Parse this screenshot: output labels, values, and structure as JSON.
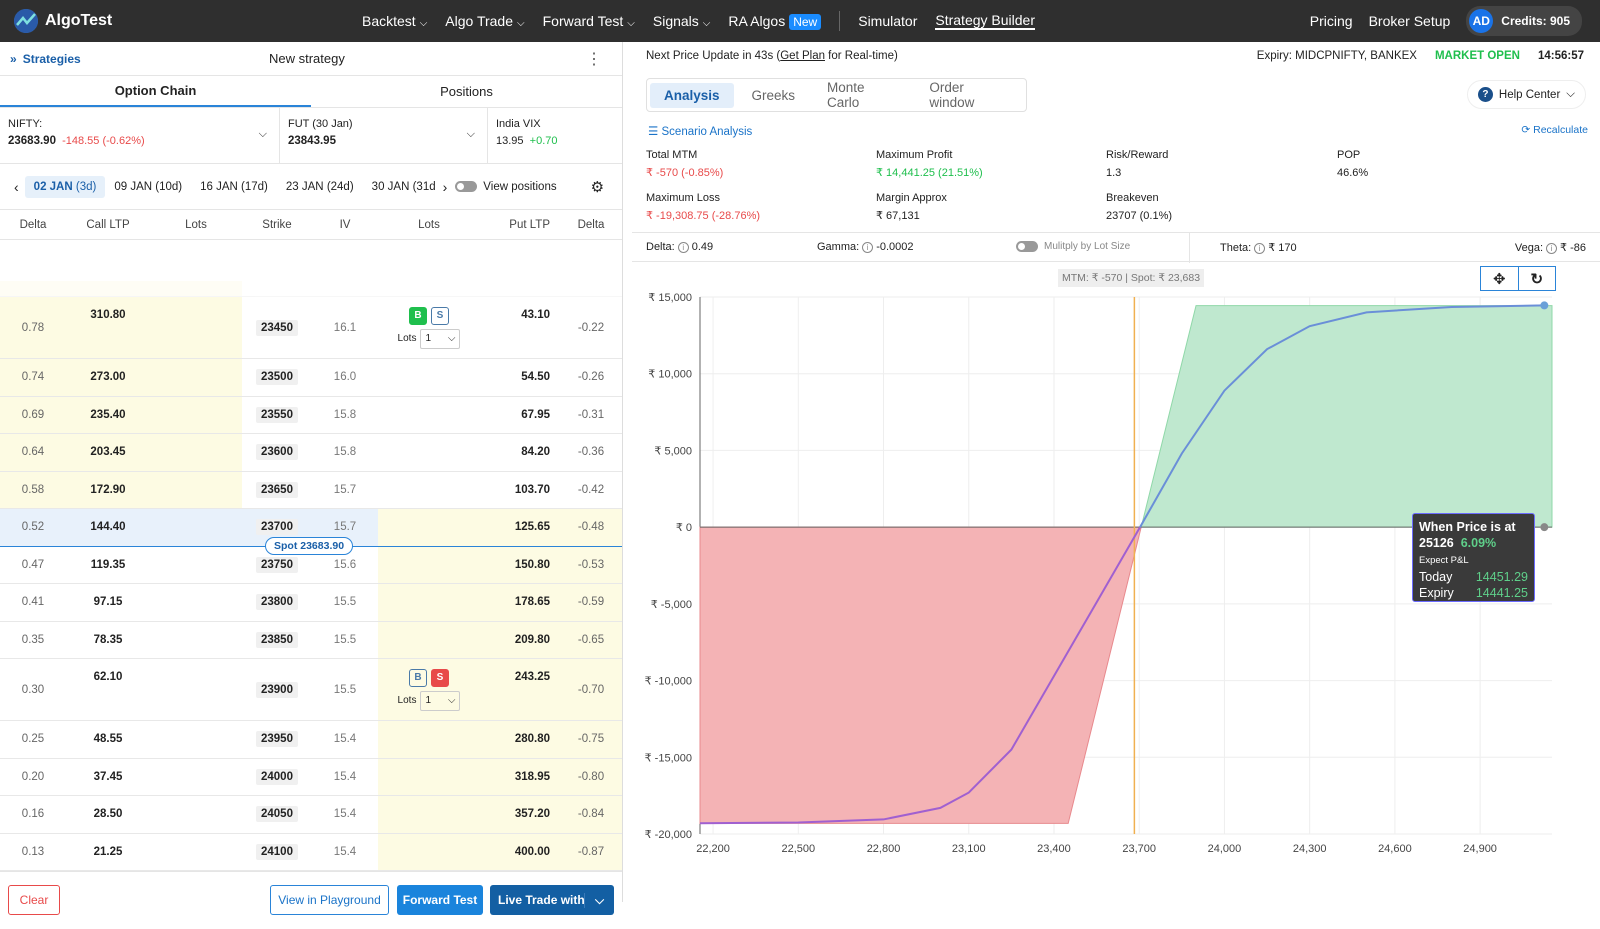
{
  "nav": {
    "brand": "AlgoTest",
    "items": [
      "Backtest",
      "Algo Trade",
      "Forward Test",
      "Signals"
    ],
    "ra_algos": "RA Algos",
    "new_badge": "New",
    "simulator": "Simulator",
    "strategy_builder": "Strategy Builder",
    "pricing": "Pricing",
    "broker_setup": "Broker Setup",
    "avatar": "AD",
    "credits": "Credits: 905"
  },
  "left": {
    "strategies": "Strategies",
    "title": "New strategy",
    "tabs": [
      "Option Chain",
      "Positions"
    ],
    "nifty": {
      "label": "NIFTY:",
      "price": "23683.90",
      "change": "-148.55 (-0.62%)"
    },
    "fut": {
      "label": "FUT (30 Jan)",
      "price": "23843.95"
    },
    "vix": {
      "label": "India VIX",
      "price": "13.95",
      "change": "+0.70"
    },
    "expiries": [
      {
        "d": "02 JAN",
        "n": "(3d)"
      },
      {
        "d": "09 JAN",
        "n": "(10d)"
      },
      {
        "d": "16 JAN",
        "n": "(17d)"
      },
      {
        "d": "23 JAN",
        "n": "(24d)"
      },
      {
        "d": "30 JAN",
        "n": "(31d"
      }
    ],
    "view_positions": "View positions",
    "columns": [
      "Delta",
      "Call LTP",
      "Lots",
      "Strike",
      "IV",
      "Lots",
      "Put LTP",
      "Delta"
    ],
    "rows": [
      {
        "cd": "0.78",
        "cl": "310.80",
        "k": "23450",
        "iv": "16.1",
        "pl": "43.10",
        "pd": "-0.22",
        "sel": "B"
      },
      {
        "cd": "0.74",
        "cl": "273.00",
        "k": "23500",
        "iv": "16.0",
        "pl": "54.50",
        "pd": "-0.26"
      },
      {
        "cd": "0.69",
        "cl": "235.40",
        "k": "23550",
        "iv": "15.8",
        "pl": "67.95",
        "pd": "-0.31"
      },
      {
        "cd": "0.64",
        "cl": "203.45",
        "k": "23600",
        "iv": "15.8",
        "pl": "84.20",
        "pd": "-0.36"
      },
      {
        "cd": "0.58",
        "cl": "172.90",
        "k": "23650",
        "iv": "15.7",
        "pl": "103.70",
        "pd": "-0.42"
      },
      {
        "cd": "0.52",
        "cl": "144.40",
        "k": "23700",
        "iv": "15.7",
        "pl": "125.65",
        "pd": "-0.48",
        "atm": true
      },
      {
        "cd": "0.47",
        "cl": "119.35",
        "k": "23750",
        "iv": "15.6",
        "pl": "150.80",
        "pd": "-0.53"
      },
      {
        "cd": "0.41",
        "cl": "97.15",
        "k": "23800",
        "iv": "15.5",
        "pl": "178.65",
        "pd": "-0.59"
      },
      {
        "cd": "0.35",
        "cl": "78.35",
        "k": "23850",
        "iv": "15.5",
        "pl": "209.80",
        "pd": "-0.65"
      },
      {
        "cd": "0.30",
        "cl": "62.10",
        "k": "23900",
        "iv": "15.5",
        "pl": "243.25",
        "pd": "-0.70",
        "sel": "S"
      },
      {
        "cd": "0.25",
        "cl": "48.55",
        "k": "23950",
        "iv": "15.4",
        "pl": "280.80",
        "pd": "-0.75"
      },
      {
        "cd": "0.20",
        "cl": "37.45",
        "k": "24000",
        "iv": "15.4",
        "pl": "318.95",
        "pd": "-0.80"
      },
      {
        "cd": "0.16",
        "cl": "28.50",
        "k": "24050",
        "iv": "15.4",
        "pl": "357.20",
        "pd": "-0.84"
      },
      {
        "cd": "0.13",
        "cl": "21.25",
        "k": "24100",
        "iv": "15.4",
        "pl": "400.00",
        "pd": "-0.87"
      }
    ],
    "b": "B",
    "s": "S",
    "lots_label": "Lots",
    "lots_value": "1",
    "spot_badge": "Spot 23683.90",
    "buttons": {
      "clear": "Clear",
      "playground": "View in Playground",
      "forward": "Forward Test",
      "live": "Live Trade with"
    }
  },
  "right": {
    "update_text": "Next Price Update in 43s (",
    "get_plan": "Get Plan",
    "update_tail": " for Real-time)",
    "expiry": "Expiry:  MIDCPNIFTY, BANKEX",
    "market": "MARKET OPEN",
    "time": "14:56:57",
    "tabs": [
      "Analysis",
      "Greeks",
      "Monte Carlo",
      "Order window"
    ],
    "help": "Help Center",
    "scenario": "Scenario Analysis",
    "recalc": "Recalculate",
    "stats": [
      {
        "label": "Total MTM",
        "value": "₹ -570 (-0.85%)",
        "tone": "red"
      },
      {
        "label": "Maximum Profit",
        "value": "₹ 14,441.25 (21.51%)",
        "tone": "green"
      },
      {
        "label": "Risk/Reward",
        "value": "1.3",
        "tone": ""
      },
      {
        "label": "POP",
        "value": "46.6%",
        "tone": ""
      },
      {
        "label": "Maximum Loss",
        "value": "₹ -19,308.75 (-28.76%)",
        "tone": "red"
      },
      {
        "label": "Margin Approx",
        "value": "₹ 67,131",
        "tone": ""
      },
      {
        "label": "Breakeven",
        "value": "23707 (0.1%)",
        "tone": ""
      }
    ],
    "greeks": {
      "delta_l": "Delta:",
      "delta": "0.49",
      "gamma_l": "Gamma:",
      "gamma": "-0.0002",
      "mult": "Mulitply by Lot Size",
      "theta_l": "Theta:",
      "theta": "₹ 170",
      "vega_l": "Vega:",
      "vega": "₹ -86"
    },
    "mtm_spot": "MTM: ₹ -570  |  Spot: ₹ 23,683",
    "tooltip": {
      "title": "When Price is at",
      "price": "25126",
      "pct": "6.09%",
      "sub": "Expect P&L",
      "today_l": "Today",
      "today": "14451.29",
      "expiry_l": "Expiry",
      "expiry": "14441.25"
    }
  },
  "colors": {
    "accent": "#1a73c8",
    "profit": "#1fbf4d",
    "loss": "#e84a4a",
    "today_line": "#6a8fd8",
    "spot_line": "#f0b050"
  },
  "chart_data": {
    "type": "line",
    "xlim": [
      22154,
      25153
    ],
    "ylim": [
      -20000,
      15000
    ],
    "x_ticks": [
      22200,
      22500,
      22800,
      23100,
      23400,
      23700,
      24000,
      24300,
      24600,
      24900
    ],
    "x_tick_labels": [
      "22,200",
      "22,500",
      "22,800",
      "23,100",
      "23,400",
      "23,700",
      "24,000",
      "24,300",
      "24,600",
      "24,900"
    ],
    "y_ticks": [
      15000,
      10000,
      5000,
      0,
      -5000,
      -10000,
      -15000,
      -20000
    ],
    "y_tick_labels": [
      "₹ 15,000",
      "₹ 10,000",
      "₹ 5,000",
      "₹ 0",
      "₹ -5,000",
      "₹ -10,000",
      "₹ -15,000",
      "₹ -20,000"
    ],
    "spot": 23683,
    "expiry_payoff": [
      [
        22154,
        -19308.75
      ],
      [
        23450,
        -19308.75
      ],
      [
        23707,
        0
      ],
      [
        23900,
        14441.25
      ],
      [
        25153,
        14441.25
      ]
    ],
    "today_curve": [
      [
        22154,
        -19300
      ],
      [
        22500,
        -19250
      ],
      [
        22800,
        -19050
      ],
      [
        23000,
        -18300
      ],
      [
        23100,
        -17300
      ],
      [
        23250,
        -14500
      ],
      [
        23400,
        -9700
      ],
      [
        23550,
        -4900
      ],
      [
        23703,
        0
      ],
      [
        23850,
        4800
      ],
      [
        24000,
        8900
      ],
      [
        24150,
        11600
      ],
      [
        24300,
        13100
      ],
      [
        24500,
        14000
      ],
      [
        24800,
        14350
      ],
      [
        25126,
        14451.29
      ]
    ],
    "grid": true
  }
}
